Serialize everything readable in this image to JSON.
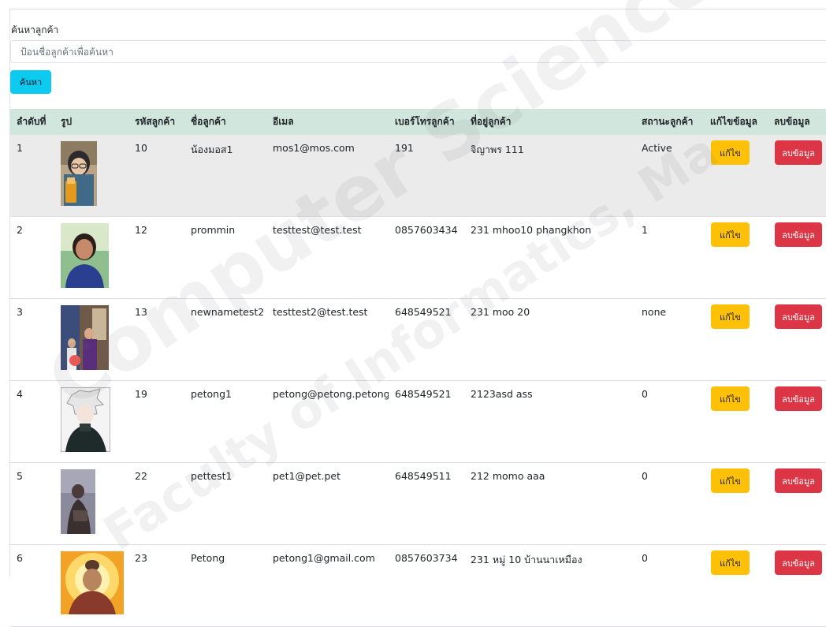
{
  "search": {
    "label": "ค้นหาลูกค้า",
    "placeholder": "ป้อนชื่อลูกค้าเพื่อค้นหา",
    "value": "",
    "button_label": "ค้นหา"
  },
  "table": {
    "headers": [
      "ลำดับที่",
      "รูป",
      "รหัสลูกค้า",
      "ชื่อลูกค้า",
      "อีเมล",
      "เบอร์โทรลูกค้า",
      "ที่อยู่ลูกค้า",
      "สถานะลูกค้า",
      "แก้ไขข้อมูล",
      "ลบข้อมูล"
    ],
    "rows": [
      {
        "no": "1",
        "id": "10",
        "name": "น้องมอส1",
        "email": "mos1@mos.com",
        "phone": "191",
        "address": "จิญาพร 111",
        "status": "Active",
        "edit_label": "แก้ไข",
        "delete_label": "ลบข้อมูล"
      },
      {
        "no": "2",
        "id": "12",
        "name": "prommin",
        "email": "testtest@test.test",
        "phone": "0857603434",
        "address": "231 mhoo10 phangkhon",
        "status": "1",
        "edit_label": "แก้ไข",
        "delete_label": "ลบข้อมูล"
      },
      {
        "no": "3",
        "id": "13",
        "name": "newnametest2",
        "email": "testtest2@test.test",
        "phone": "648549521",
        "address": "231 moo 20",
        "status": "none",
        "edit_label": "แก้ไข",
        "delete_label": "ลบข้อมูล"
      },
      {
        "no": "4",
        "id": "19",
        "name": "petong1",
        "email": "petong@petong.petong",
        "phone": "648549521",
        "address": "2123asd ass",
        "status": "0",
        "edit_label": "แก้ไข",
        "delete_label": "ลบข้อมูล"
      },
      {
        "no": "5",
        "id": "22",
        "name": "pettest1",
        "email": "pet1@pet.pet",
        "phone": "648549511",
        "address": "212 momo aaa",
        "status": "0",
        "edit_label": "แก้ไข",
        "delete_label": "ลบข้อมูล"
      },
      {
        "no": "6",
        "id": "23",
        "name": "Petong",
        "email": "petong1@gmail.com",
        "phone": "0857603734",
        "address": "231 หมู่ 10 บ้านนาเหมือง",
        "status": "0",
        "edit_label": "แก้ไข",
        "delete_label": "ลบข้อมูล"
      }
    ]
  },
  "watermark": {
    "line1": "Computer Science, Mah",
    "line2": "Faculty of Informatics, Ma"
  },
  "colors": {
    "header_bg": "#d1e7dd",
    "search_button": "#0dcaf0",
    "edit_button": "#ffc107",
    "delete_button": "#dc3545",
    "highlight_row": "#ebebeb"
  }
}
